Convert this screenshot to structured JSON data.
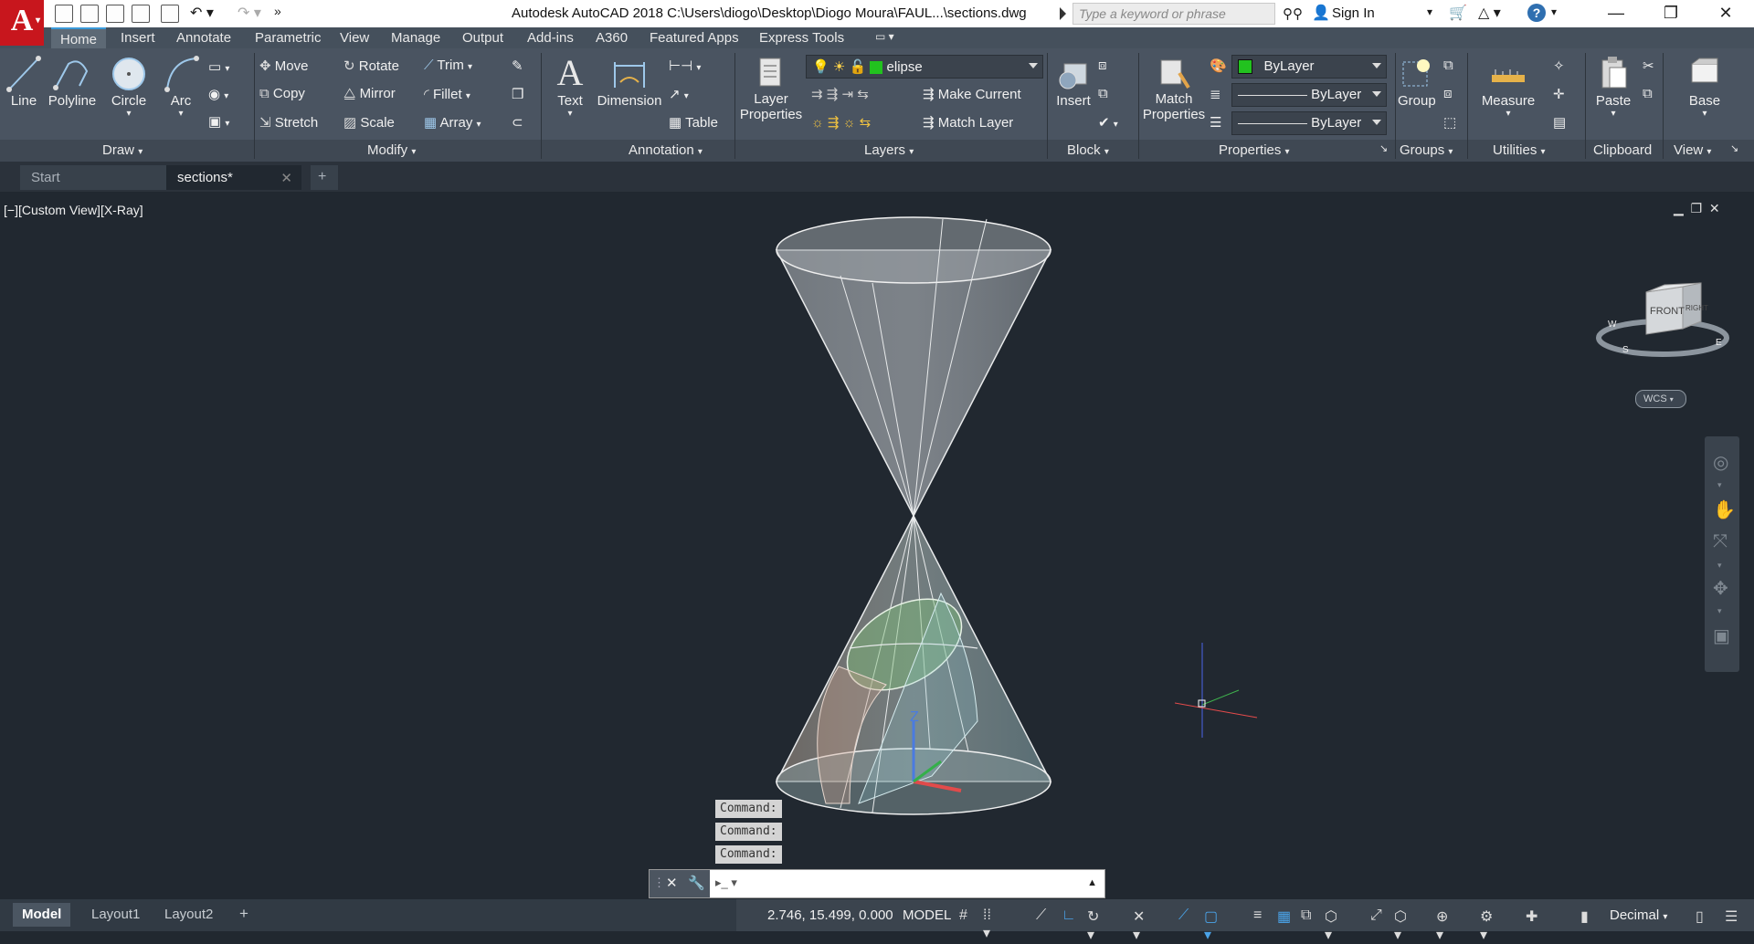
{
  "app": {
    "logo_letter": "A",
    "title": "Autodesk AutoCAD 2018    C:\\Users\\diogo\\Desktop\\Diogo Moura\\FAUL...\\sections.dwg",
    "search_placeholder": "Type a keyword or phrase",
    "sign_in": "Sign In"
  },
  "ribbon_tabs": [
    "Home",
    "Insert",
    "Annotate",
    "Parametric",
    "View",
    "Manage",
    "Output",
    "Add-ins",
    "A360",
    "Featured Apps",
    "Express Tools"
  ],
  "draw": {
    "title": "Draw",
    "line": "Line",
    "polyline": "Polyline",
    "circle": "Circle",
    "arc": "Arc"
  },
  "modify": {
    "title": "Modify",
    "move": "Move",
    "rotate": "Rotate",
    "trim": "Trim",
    "copy": "Copy",
    "mirror": "Mirror",
    "fillet": "Fillet",
    "stretch": "Stretch",
    "scale": "Scale",
    "array": "Array"
  },
  "annotation": {
    "title": "Annotation",
    "text": "Text",
    "dimension": "Dimension",
    "table": "Table"
  },
  "layers": {
    "title": "Layers",
    "layer_properties_1": "Layer",
    "layer_properties_2": "Properties",
    "current_layer": "elipse",
    "make_current": "Make Current",
    "match_layer": "Match Layer"
  },
  "block": {
    "title": "Block",
    "insert": "Insert"
  },
  "properties": {
    "title": "Properties",
    "match_1": "Match",
    "match_2": "Properties",
    "color": "ByLayer",
    "linetype": "ByLayer",
    "lineweight": "ByLayer"
  },
  "groups": {
    "title": "Groups",
    "group": "Group"
  },
  "utilities": {
    "title": "Utilities",
    "measure": "Measure"
  },
  "clipboard": {
    "title": "Clipboard",
    "paste": "Paste"
  },
  "view_panel": {
    "title": "View",
    "base": "Base"
  },
  "doc_tabs": {
    "start": "Start",
    "sections": "sections*"
  },
  "viewport": {
    "label": "[−][Custom View][X-Ray]",
    "viewcube_front": "FRONT",
    "viewcube_right": "RIGHT",
    "wcs": "WCS",
    "compass_s": "S",
    "compass_w": "W",
    "compass_e": "E"
  },
  "command_history": [
    "Command:",
    "Command:",
    "Command:"
  ],
  "layout_tabs": {
    "model": "Model",
    "layout1": "Layout1",
    "layout2": "Layout2"
  },
  "status": {
    "coords": "2.746, 15.499, 0.000",
    "mode": "MODEL",
    "units": "Decimal"
  },
  "colors": {
    "accent": "#3a9ad9",
    "layer_green": "#22c21f",
    "logo_red": "#c8161d"
  }
}
